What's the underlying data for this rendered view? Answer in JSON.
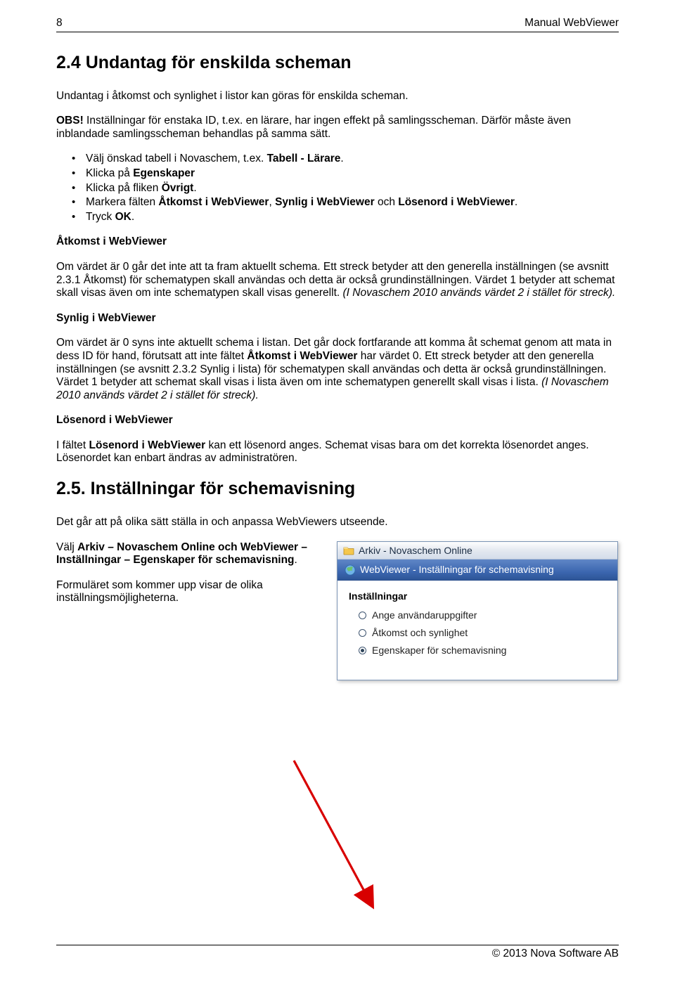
{
  "header": {
    "page_number": "8",
    "doc_title": "Manual WebViewer"
  },
  "section24": {
    "title": "2.4 Undantag för enskilda scheman",
    "intro": "Undantag i åtkomst och synlighet i listor kan göras för enskilda scheman.",
    "obs_label": "OBS!",
    "obs_text": " Inställningar för enstaka ID, t.ex. en lärare, har ingen effekt på samlingsscheman. Därför måste även inblandade samlingsscheman behandlas på samma sätt.",
    "bullets": {
      "b1a": "Välj önskad tabell i Novaschem, t.ex. ",
      "b1b": "Tabell - Lärare",
      "b1c": ".",
      "b2a": "Klicka på ",
      "b2b": "Egenskaper",
      "b3a": "Klicka på fliken ",
      "b3b": "Övrigt",
      "b3c": ".",
      "b4a": "Markera fälten ",
      "b4b": "Åtkomst i WebViewer",
      "b4c": ", ",
      "b4d": "Synlig i WebViewer",
      "b4e": " och ",
      "b4f": "Lösenord i WebViewer",
      "b4g": ".",
      "b5a": "Tryck ",
      "b5b": "OK",
      "b5c": "."
    },
    "atkomst_title": "Åtkomst i WebViewer",
    "atkomst_text_a": "Om värdet är 0 går det inte att ta fram aktuellt schema. Ett streck betyder att den generella inställningen (se avsnitt 2.3.1 Åtkomst) för schematypen skall användas och detta är också grundinställningen. Värdet 1 betyder att schemat skall visas även om inte schematypen skall visas generellt. ",
    "atkomst_text_b": "(I Novaschem 2010 används värdet 2 i stället för streck).",
    "synlig_title": "Synlig i WebViewer",
    "synlig_text_a": "Om värdet är 0 syns inte aktuellt schema i listan. Det går dock fortfarande att komma åt schemat genom att mata in dess ID för hand, förutsatt att inte fältet ",
    "synlig_text_b": "Åtkomst i WebViewer",
    "synlig_text_c": " har värdet 0. Ett streck betyder att den generella inställningen (se avsnitt 2.3.2 Synlig i lista) för schematypen skall användas och detta är också grundinställningen. Värdet 1 betyder att schemat skall visas i lista även om inte schematypen generellt skall visas i lista. ",
    "synlig_text_d": "(I Novaschem 2010 används värdet 2 i stället för streck).",
    "losenord_title": "Lösenord i WebViewer",
    "losenord_text_a": "I fältet ",
    "losenord_text_b": "Lösenord i WebViewer",
    "losenord_text_c": " kan ett lösenord anges. Schemat visas bara om det korrekta lösenordet anges. Lösenordet kan enbart ändras av administratören."
  },
  "section25": {
    "title": "2.5. Inställningar för schemavisning",
    "intro": "Det går att på olika sätt ställa in och anpassa WebViewers utseende.",
    "step1a": "Välj ",
    "step1b": "Arkiv – Novaschem Online och WebViewer – Inställningar – Egenskaper för schemavisning",
    "step1c": ".",
    "step2": "Formuläret som kommer upp visar de olika inställningsmöjligheterna."
  },
  "win": {
    "titlebar": "Arkiv - Novaschem Online",
    "menubar": "WebViewer - Inställningar för schemavisning",
    "group_title": "Inställningar",
    "radio1": "Ange användaruppgifter",
    "radio2": "Åtkomst och synlighet",
    "radio3": "Egenskaper för schemavisning"
  },
  "footer": {
    "copyright": "© 2013 Nova Software AB"
  }
}
